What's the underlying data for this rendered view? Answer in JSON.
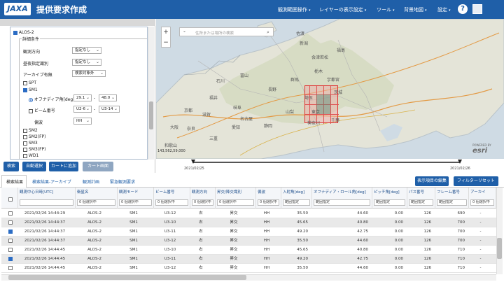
{
  "header": {
    "logo": "JAXA",
    "title": "提供要求作成",
    "menus": [
      "観測範囲操作",
      "レイヤーの表示設定",
      "ツール",
      "背景地図",
      "設定"
    ],
    "help": "?"
  },
  "criteria": {
    "satellite": "ALOS-2",
    "section": "詳細条件",
    "rows": [
      {
        "label": "観測方向",
        "value": "指定なし"
      },
      {
        "label": "昼夜指定識別",
        "value": "指定なし"
      },
      {
        "label": "アーカイブ有無",
        "value": "検索対象外"
      }
    ],
    "modes": [
      "SPT",
      "SM1"
    ],
    "offnadir_label": "オフナディア角[deg]",
    "offnadir_from": "29.1",
    "offnadir_sep": "-",
    "offnadir_to": "48.0",
    "beam_label": "ビーム番号",
    "beam_from": "U2-6",
    "beam_sep": "-",
    "beam_to": "U3-14",
    "pol_label": "偏波",
    "pol_value": "HH",
    "more_modes": [
      "SM2",
      "SM2(FP)",
      "SM3",
      "SM3(FP)",
      "WD1"
    ]
  },
  "buttons": {
    "search": "検索",
    "auto_select": "自動選択",
    "add_cart": "カートに追加",
    "cart": "カート画面"
  },
  "map": {
    "search_placeholder": "住所または場所の検索",
    "zoom_in": "+",
    "zoom_out": "−",
    "attribution": "esri",
    "attribution_sub": "POWERED BY",
    "scale": "143,562,59,000",
    "places": [
      "佐渡",
      "新潟",
      "石川",
      "富山",
      "長野",
      "群馬",
      "栃木",
      "埼玉",
      "茨城",
      "千葉",
      "東京",
      "山梨",
      "静岡",
      "愛知",
      "岐阜",
      "福井",
      "滋賀",
      "京都",
      "奈良",
      "三重",
      "大阪",
      "和歌山",
      "神奈川",
      "福島",
      "会津若松",
      "宇都宮",
      "名古屋"
    ]
  },
  "timeline": {
    "start": "2021/02/25",
    "end": "2021/02/26"
  },
  "tabs": [
    "検索結果",
    "検索結果-アーカイブ",
    "観測計画",
    "緊急観測要求"
  ],
  "table_buttons": {
    "columns": "表示項目の編集",
    "reset": "フィルターリセット"
  },
  "table": {
    "columns": [
      {
        "label": "観測中心日時[UTC]",
        "filter": ""
      },
      {
        "label": "衛星名",
        "filter": "0 個選択中"
      },
      {
        "label": "観測モード",
        "filter": "0 個選択中"
      },
      {
        "label": "ビーム番号",
        "filter": "0 個選択中"
      },
      {
        "label": "観測方向",
        "filter": "0 個選択中"
      },
      {
        "label": "昇交/降交識別",
        "filter": "0 個選択中"
      },
      {
        "label": "偏波",
        "filter": "0 個選択中"
      },
      {
        "label": "入射角[deg]",
        "filter": "範囲指定"
      },
      {
        "label": "オフナディア・ロール角[deg]",
        "filter": "範囲指定"
      },
      {
        "label": "ピッチ角[deg]",
        "filter": "範囲指定"
      },
      {
        "label": "パス番号",
        "filter": "範囲指定"
      },
      {
        "label": "フレーム番号",
        "filter": "範囲指定"
      },
      {
        "label": "アーカイ",
        "filter": "0 個選択中"
      }
    ],
    "rows": [
      {
        "checked": false,
        "cells": [
          "2021/02/26 14:44:29",
          "ALOS-2",
          "SM1",
          "U3-12",
          "右",
          "昇交",
          "HH",
          "35.50",
          "44.60",
          "0.00",
          "126",
          "690",
          "-"
        ]
      },
      {
        "checked": false,
        "cells": [
          "2021/02/26 14:44:37",
          "ALOS-2",
          "SM1",
          "U3-10",
          "右",
          "昇交",
          "HH",
          "45.65",
          "40.80",
          "0.00",
          "126",
          "700",
          "-"
        ]
      },
      {
        "checked": true,
        "cells": [
          "2021/02/26 14:44:37",
          "ALOS-2",
          "SM1",
          "U3-11",
          "右",
          "昇交",
          "HH",
          "49.20",
          "42.75",
          "0.00",
          "126",
          "700",
          "-"
        ]
      },
      {
        "checked": false,
        "cells": [
          "2021/02/26 14:44:37",
          "ALOS-2",
          "SM1",
          "U3-12",
          "右",
          "昇交",
          "HH",
          "35.50",
          "44.60",
          "0.00",
          "126",
          "700",
          "-"
        ]
      },
      {
        "checked": false,
        "cells": [
          "2021/02/26 14:44:45",
          "ALOS-2",
          "SM1",
          "U3-10",
          "右",
          "昇交",
          "HH",
          "45.65",
          "40.80",
          "0.00",
          "126",
          "710",
          "-"
        ]
      },
      {
        "checked": true,
        "cells": [
          "2021/02/26 14:44:45",
          "ALOS-2",
          "SM1",
          "U3-11",
          "右",
          "昇交",
          "HH",
          "49.20",
          "42.75",
          "0.00",
          "126",
          "710",
          "-"
        ]
      },
      {
        "checked": false,
        "cells": [
          "2021/02/26 14:44:45",
          "ALOS-2",
          "SM1",
          "U3-12",
          "右",
          "昇交",
          "HH",
          "35.50",
          "44.60",
          "0.00",
          "126",
          "710",
          "-"
        ]
      }
    ]
  },
  "colors": {
    "header": "#1f5fa8",
    "button": "#1f5fa8",
    "button_disabled": "#8fa6c1",
    "footprint": "#e03030",
    "footprint_fill": "#f2a8a8"
  }
}
